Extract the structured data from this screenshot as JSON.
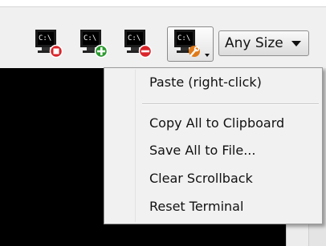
{
  "toolbar": {
    "buttons": [
      {
        "icon": "terminal-icon",
        "badge": "close-badge-icon",
        "badge_color": "#d9252b",
        "glyph": "C:\\"
      },
      {
        "icon": "terminal-icon",
        "badge": "add-badge-icon",
        "badge_color": "#2a9a2e",
        "glyph": "C:\\"
      },
      {
        "icon": "terminal-icon",
        "badge": "remove-badge-icon",
        "badge_color": "#d9252b",
        "glyph": "C:\\"
      },
      {
        "icon": "terminal-icon",
        "badge": "wrench-badge-icon",
        "badge_color": "#e07a18",
        "glyph": "C:\\",
        "has_dropdown": true,
        "active": true
      }
    ],
    "size_select": {
      "value": "Any Size"
    }
  },
  "context_menu": {
    "items": [
      {
        "label": "Paste  (right-click)"
      },
      {
        "label": "Copy All to Clipboard"
      },
      {
        "label": "Save All to File..."
      },
      {
        "label": "Clear Scrollback"
      },
      {
        "label": "Reset Terminal"
      }
    ]
  }
}
